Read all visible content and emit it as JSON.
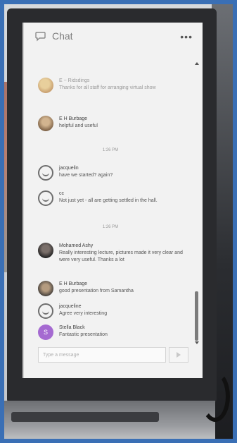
{
  "header": {
    "title": "Chat",
    "menu_label": "•••"
  },
  "messages": [
    {
      "name": "E ~ Ridsdings",
      "text": "Thanks for all staff for arranging virtual show",
      "faded": true
    },
    {
      "name": "E H Burbage",
      "text": "helpful and useful",
      "faded": false
    }
  ],
  "time_separators": [
    "1:26 PM",
    "1:26 PM"
  ],
  "messages2": [
    {
      "name": "jacquelin",
      "text": "have we started? again?"
    },
    {
      "name": "cc",
      "text": "Not just yet - all are getting settled in the hall."
    }
  ],
  "messages3": [
    {
      "name": "Mohamed Ashy",
      "text": "Really interesting lecture, pictures made it very clear and were very useful. Thanks a lot"
    },
    {
      "name": "E H Burbage",
      "text": "good presentation from Samantha"
    },
    {
      "name": "jacqueline",
      "text": "Agree very interesting"
    },
    {
      "name": "Stella Black",
      "text": "Fantastic presentation"
    }
  ],
  "avatar_letter": "S",
  "composer": {
    "placeholder": "Type a message"
  }
}
